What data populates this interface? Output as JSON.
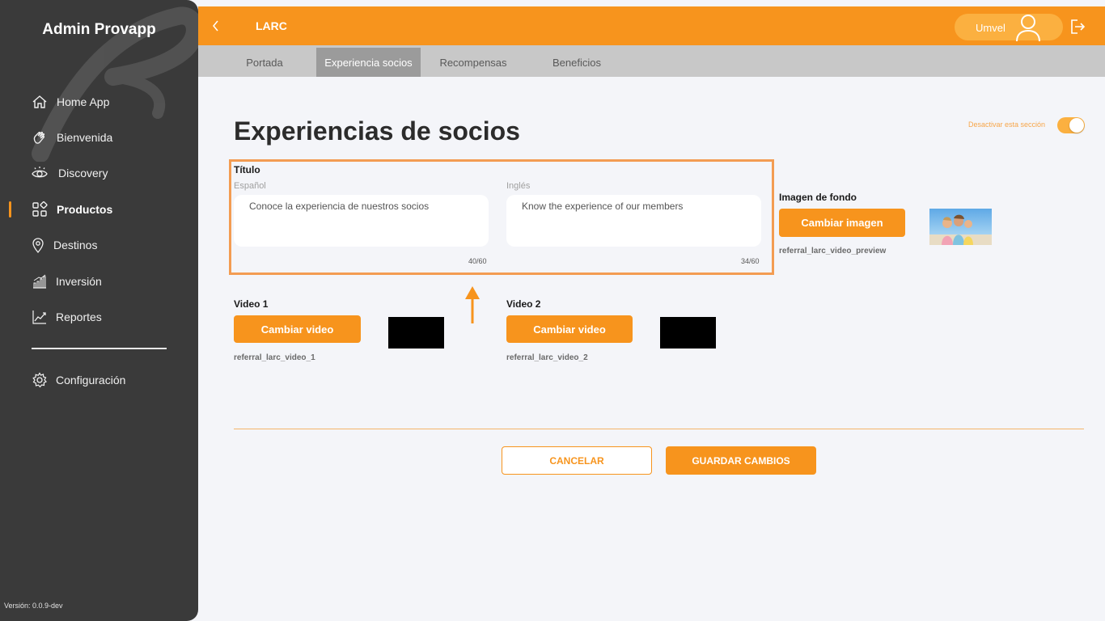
{
  "sidebar": {
    "title": "Admin Provapp",
    "items": [
      {
        "label": "Home App",
        "icon": "home-icon"
      },
      {
        "label": "Bienvenida",
        "icon": "wave-hand-icon"
      },
      {
        "label": "Discovery",
        "icon": "eye-icon"
      },
      {
        "label": "Productos",
        "icon": "grid-icon",
        "active": true
      },
      {
        "label": "Destinos",
        "icon": "map-pin-icon"
      },
      {
        "label": "Inversión",
        "icon": "bar-chart-icon"
      },
      {
        "label": "Reportes",
        "icon": "line-chart-icon"
      }
    ],
    "settings_label": "Configuración",
    "version": "Versión: 0.0.9-dev"
  },
  "topbar": {
    "title": "LARC",
    "user_name": "Umvel"
  },
  "tabs": [
    {
      "label": "Portada"
    },
    {
      "label": "Experiencia socios",
      "active": true
    },
    {
      "label": "Recompensas"
    },
    {
      "label": "Beneficios"
    }
  ],
  "main": {
    "page_title": "Experiencias de socios",
    "toggle_label": "Desactivar esta sección",
    "title_section": {
      "label": "Título",
      "spanish_label": "Español",
      "spanish_value": "Conoce la experiencia de nuestros socios",
      "spanish_counter": "40/60",
      "english_label": "Inglés",
      "english_value": "Know the experience of our members",
      "english_counter": "34/60"
    },
    "background": {
      "label": "Imagen de fondo",
      "button": "Cambiar imagen",
      "file": "referral_larc_video_preview"
    },
    "video1": {
      "label": "Video 1",
      "button": "Cambiar video",
      "file": "referral_larc_video_1"
    },
    "video2": {
      "label": "Video 2",
      "button": "Cambiar video",
      "file": "referral_larc_video_2"
    },
    "cancel_label": "CANCELAR",
    "save_label": "GUARDAR CAMBIOS"
  },
  "colors": {
    "accent": "#f7941d",
    "sidebar_bg": "#3a3a3a",
    "tab_bar_bg": "#c8c8c8"
  }
}
